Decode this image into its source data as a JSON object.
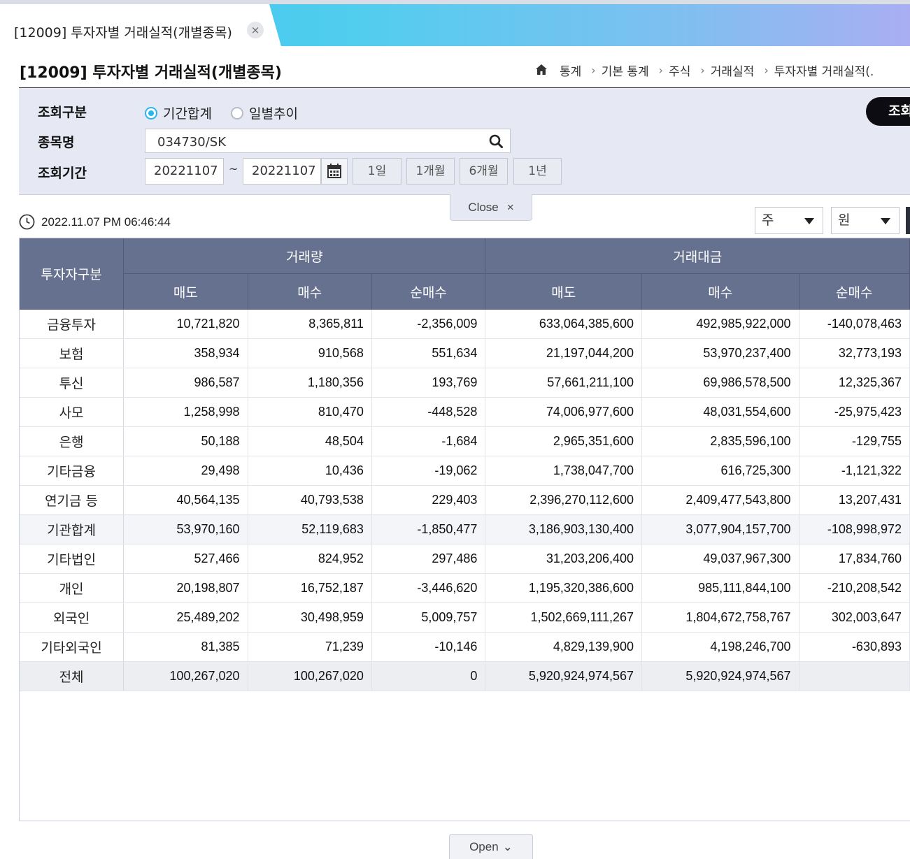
{
  "tab": {
    "title": "[12009] 투자자별 거래실적(개별종목)",
    "close_glyph": "×"
  },
  "page_title": "[12009] 투자자별 거래실적(개별종목)",
  "breadcrumb": [
    "통계",
    "기본 통계",
    "주식",
    "거래실적",
    "투자자별 거래실적(."
  ],
  "search": {
    "type_label": "조회구분",
    "radio_period": "기간합계",
    "radio_daily": "일별추이",
    "selected": "기간합계",
    "stock_label": "종목명",
    "stock_value": "034730/SK",
    "date_label": "조회기간",
    "date_from": "20221107",
    "date_tilde": "~",
    "date_to": "20221107",
    "period_buttons": [
      "1일",
      "1개월",
      "6개월",
      "1년"
    ],
    "query_button": "조회"
  },
  "close_tab": {
    "label": "Close",
    "glyph": "×"
  },
  "timestamp": "2022.11.07 PM 06:46:44",
  "units": {
    "volume_unit": "주",
    "amount_unit": "원"
  },
  "table": {
    "header_category": "투자자구분",
    "group_volume": "거래량",
    "group_amount": "거래대금",
    "sub_sell": "매도",
    "sub_buy": "매수",
    "sub_net": "순매수",
    "rows": [
      [
        "금융투자",
        "10,721,820",
        "8,365,811",
        "-2,356,009",
        "633,064,385,600",
        "492,985,922,000",
        "-140,078,463"
      ],
      [
        "보험",
        "358,934",
        "910,568",
        "551,634",
        "21,197,044,200",
        "53,970,237,400",
        "32,773,193"
      ],
      [
        "투신",
        "986,587",
        "1,180,356",
        "193,769",
        "57,661,211,100",
        "69,986,578,500",
        "12,325,367"
      ],
      [
        "사모",
        "1,258,998",
        "810,470",
        "-448,528",
        "74,006,977,600",
        "48,031,554,600",
        "-25,975,423"
      ],
      [
        "은행",
        "50,188",
        "48,504",
        "-1,684",
        "2,965,351,600",
        "2,835,596,100",
        "-129,755"
      ],
      [
        "기타금융",
        "29,498",
        "10,436",
        "-19,062",
        "1,738,047,700",
        "616,725,300",
        "-1,121,322"
      ],
      [
        "연기금 등",
        "40,564,135",
        "40,793,538",
        "229,403",
        "2,396,270,112,600",
        "2,409,477,543,800",
        "13,207,431"
      ],
      [
        "기관합계",
        "53,970,160",
        "52,119,683",
        "-1,850,477",
        "3,186,903,130,400",
        "3,077,904,157,700",
        "-108,998,972"
      ],
      [
        "기타법인",
        "527,466",
        "824,952",
        "297,486",
        "31,203,206,400",
        "49,037,967,300",
        "17,834,760"
      ],
      [
        "개인",
        "20,198,807",
        "16,752,187",
        "-3,446,620",
        "1,195,320,386,600",
        "985,111,844,100",
        "-210,208,542"
      ],
      [
        "외국인",
        "25,489,202",
        "30,498,959",
        "5,009,757",
        "1,502,669,111,267",
        "1,804,672,758,767",
        "302,003,647"
      ],
      [
        "기타외국인",
        "81,385",
        "71,239",
        "-10,146",
        "4,829,139,900",
        "4,198,246,700",
        "-630,893"
      ],
      [
        "전체",
        "100,267,020",
        "100,267,020",
        "0",
        "5,920,924,974,567",
        "5,920,924,974,567",
        ""
      ]
    ]
  },
  "open_tab": {
    "label": "Open",
    "glyph": "⌄"
  },
  "colors": {
    "header_bg": "#66718f",
    "panel_bg": "#e6e9f4",
    "radio_accent": "#2bb6e6",
    "query_button_bg": "#0c0c12",
    "tab_gradient_start": "#37c6ee",
    "tab_gradient_end": "#a9aef2"
  },
  "icons": [
    "home-icon",
    "chevron-right-icon",
    "search-icon",
    "calendar-icon",
    "clock-icon",
    "caret-down-icon",
    "close-icon",
    "chevron-down-icon"
  ]
}
